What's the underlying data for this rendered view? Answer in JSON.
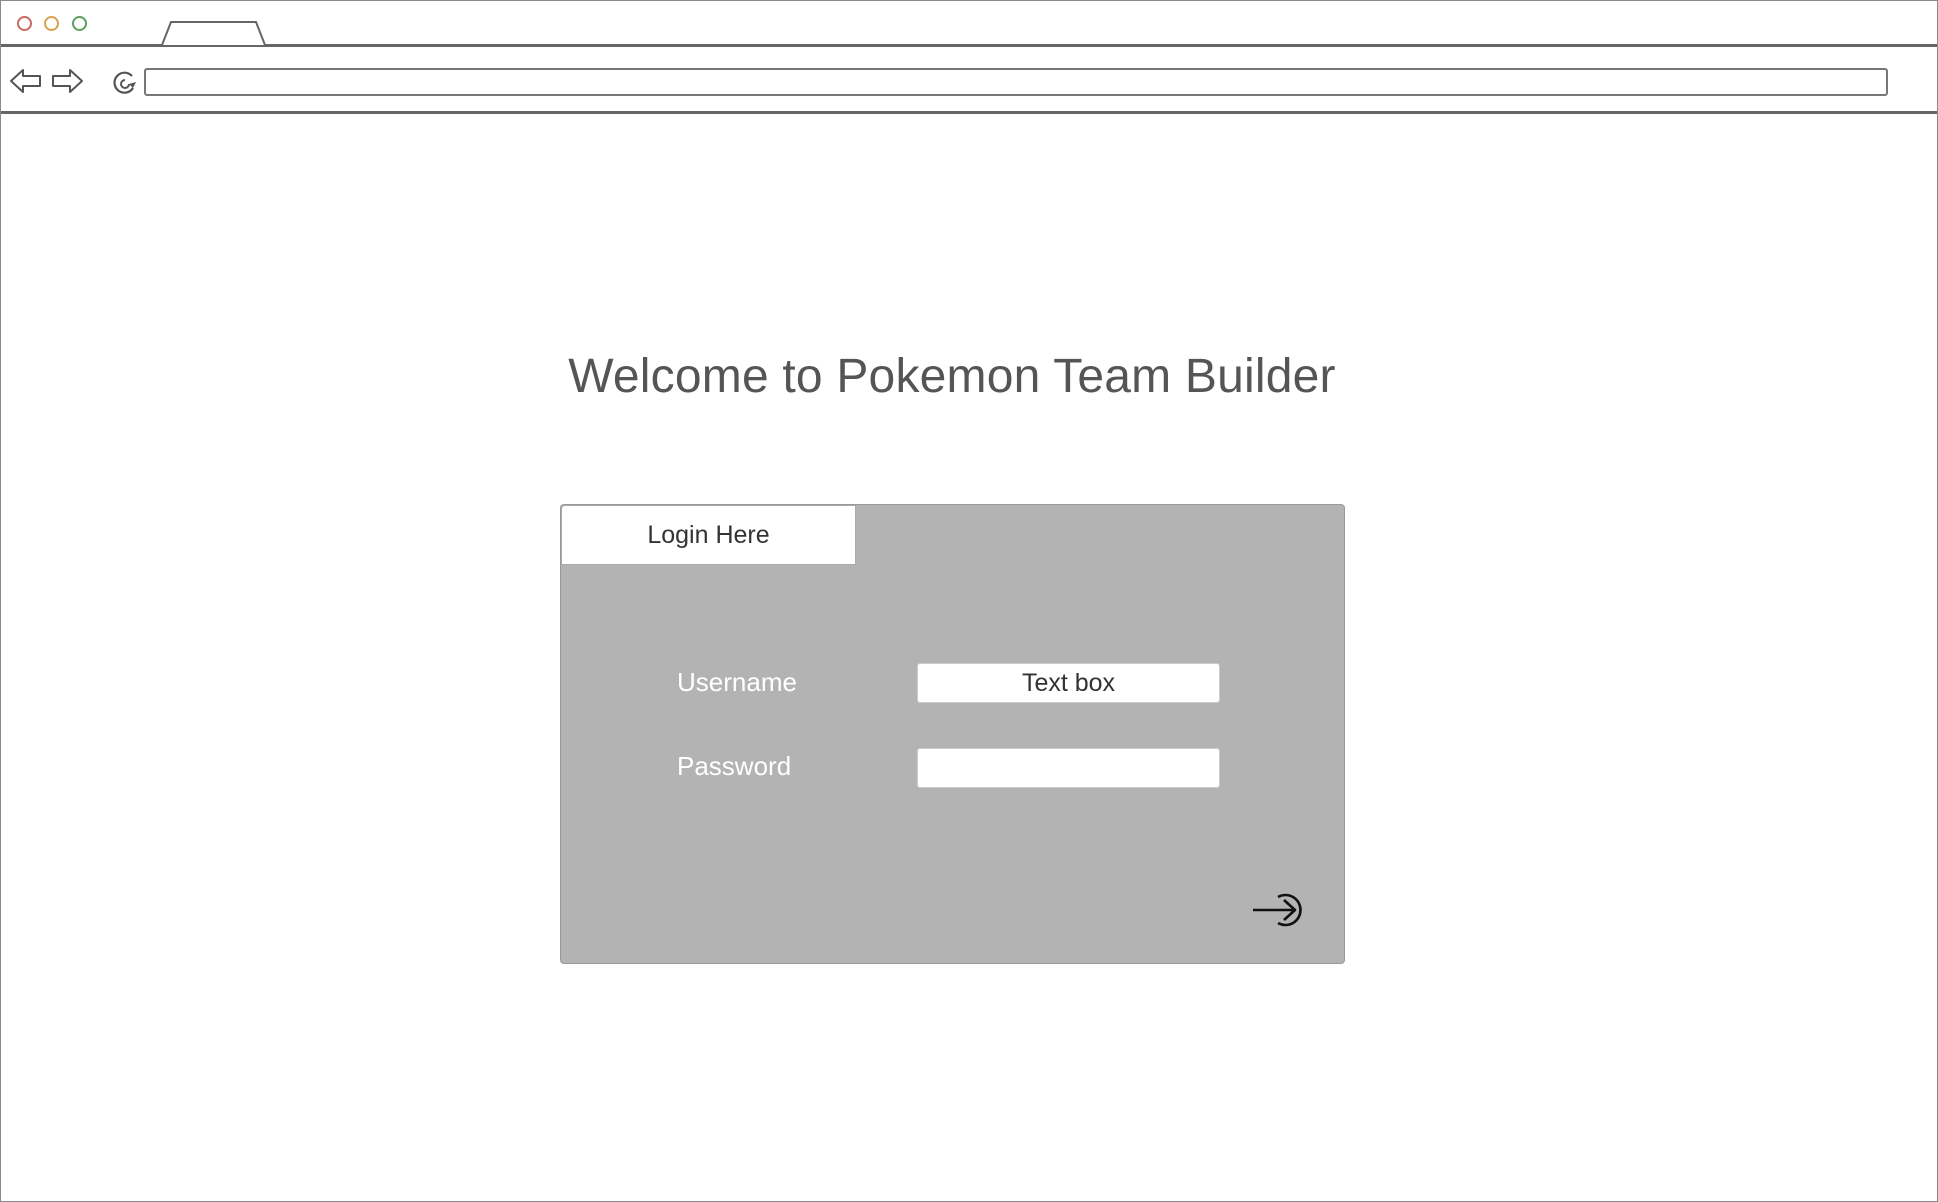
{
  "browser": {
    "address_value": "",
    "icons": [
      "window-close-dot",
      "window-minimize-dot",
      "window-maximize-dot",
      "back-arrow-icon",
      "forward-arrow-icon",
      "reload-icon"
    ],
    "colors": {
      "close": "#c96a5e",
      "minimize": "#d8a24a",
      "maximize": "#5aa05a"
    }
  },
  "page": {
    "title": "Welcome to Pokemon Team Builder"
  },
  "login": {
    "tab_label": "Login Here",
    "username_label": "Username",
    "username_value": "Text box",
    "password_label": "Password",
    "password_value": "",
    "submit_icon": "login-arrow-icon",
    "panel_color": "#b3b3b3"
  }
}
